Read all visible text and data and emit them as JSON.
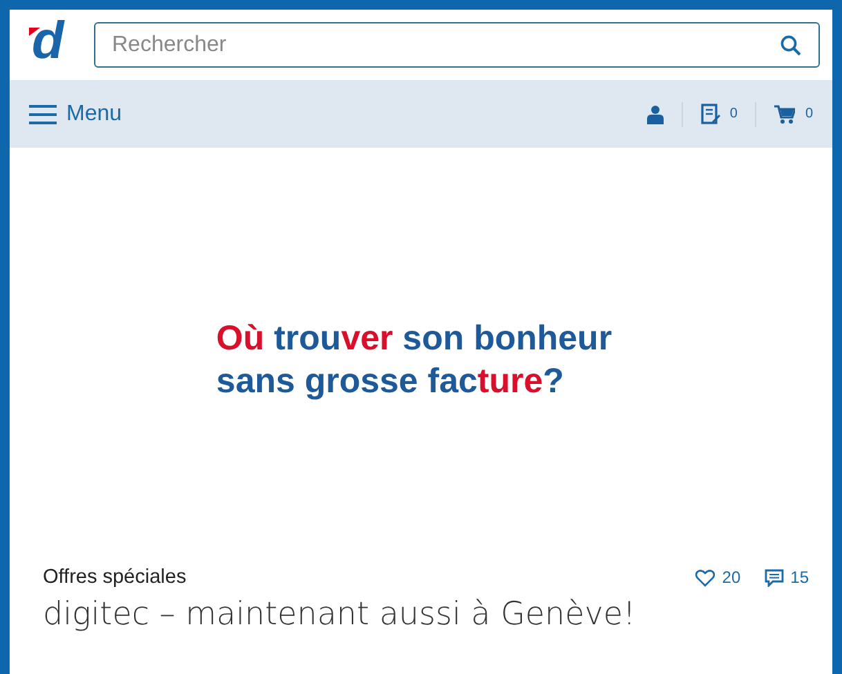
{
  "logo": {
    "text": "d"
  },
  "search": {
    "placeholder": "Rechercher"
  },
  "nav": {
    "menu_label": "Menu",
    "wishlist_count": "0",
    "cart_count": "0"
  },
  "banner": {
    "lines": [
      [
        {
          "text": "Où",
          "accent": true
        },
        {
          "text": " trou",
          "accent": false
        },
        {
          "text": "ver",
          "accent": true
        },
        {
          "text": " son bonheur",
          "accent": false
        }
      ],
      [
        {
          "text": "sans grosse fac",
          "accent": false
        },
        {
          "text": "ture",
          "accent": true
        },
        {
          "text": "?",
          "accent": false
        }
      ]
    ]
  },
  "article": {
    "category": "Offres spéciales",
    "likes": "20",
    "comments": "15",
    "title": "digitec – maintenant aussi à Genève!"
  }
}
